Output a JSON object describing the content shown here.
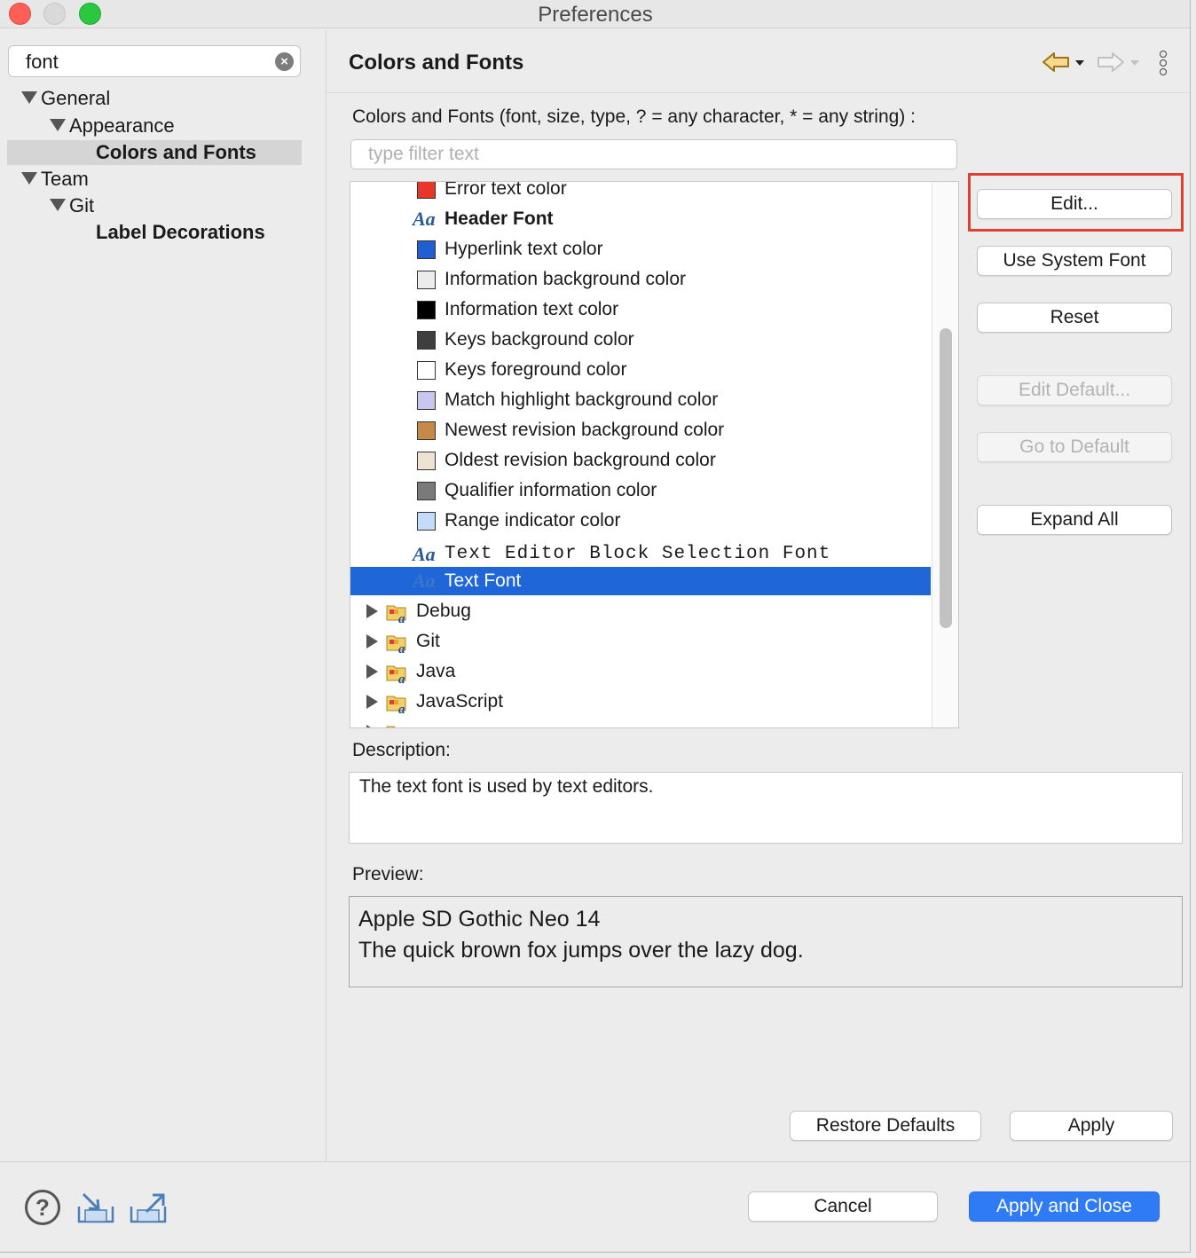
{
  "window": {
    "title": "Preferences"
  },
  "sidebar": {
    "search_value": "font",
    "tree": [
      {
        "label": "General"
      },
      {
        "label": "Appearance"
      },
      {
        "label": "Colors and Fonts"
      },
      {
        "label": "Team"
      },
      {
        "label": "Git"
      },
      {
        "label": "Label Decorations"
      }
    ]
  },
  "main": {
    "title": "Colors and Fonts",
    "filter_label": "Colors and Fonts (font, size, type, ? = any character, * = any string) :",
    "filter_placeholder": "type filter text",
    "items": [
      {
        "label": "Error text color",
        "type": "color",
        "color": "#e8362a"
      },
      {
        "label": "Header Font",
        "type": "font"
      },
      {
        "label": "Hyperlink text color",
        "type": "color",
        "color": "#1f5fd3"
      },
      {
        "label": "Information background color",
        "type": "color",
        "color": "#ececec"
      },
      {
        "label": "Information text color",
        "type": "color",
        "color": "#000000"
      },
      {
        "label": "Keys background color",
        "type": "color",
        "color": "#3f3f3f"
      },
      {
        "label": "Keys foreground color",
        "type": "color",
        "color": "#ffffff"
      },
      {
        "label": "Match highlight background color",
        "type": "color",
        "color": "#c9c6f0"
      },
      {
        "label": "Newest revision background color",
        "type": "color",
        "color": "#c68a46"
      },
      {
        "label": "Oldest revision background color",
        "type": "color",
        "color": "#f0e2d3"
      },
      {
        "label": "Qualifier information color",
        "type": "color",
        "color": "#7a7a7a"
      },
      {
        "label": "Range indicator color",
        "type": "color",
        "color": "#c2dcfa"
      },
      {
        "label": "Text Editor Block Selection Font",
        "type": "font"
      },
      {
        "label": "Text Font",
        "type": "font"
      }
    ],
    "categories": [
      {
        "label": "Debug"
      },
      {
        "label": "Git"
      },
      {
        "label": "Java"
      },
      {
        "label": "JavaScript"
      }
    ],
    "font_icon_text": "Aa",
    "buttons": {
      "edit": "Edit...",
      "use_system_font": "Use System Font",
      "reset": "Reset",
      "edit_default": "Edit Default...",
      "go_to_default": "Go to Default",
      "expand_all": "Expand All"
    },
    "description_label": "Description:",
    "description_text": "The text font is used by text editors.",
    "preview_label": "Preview:",
    "preview_line1": "Apple SD Gothic Neo 14",
    "preview_line2": "The quick brown fox jumps over the lazy dog.",
    "restore_defaults": "Restore Defaults",
    "apply": "Apply"
  },
  "footer": {
    "cancel": "Cancel",
    "apply_and_close": "Apply and Close"
  },
  "colors": {
    "accent": "#1f66d8",
    "highlight_box": "#e0402e",
    "primary_button": "#2f7bf5"
  }
}
